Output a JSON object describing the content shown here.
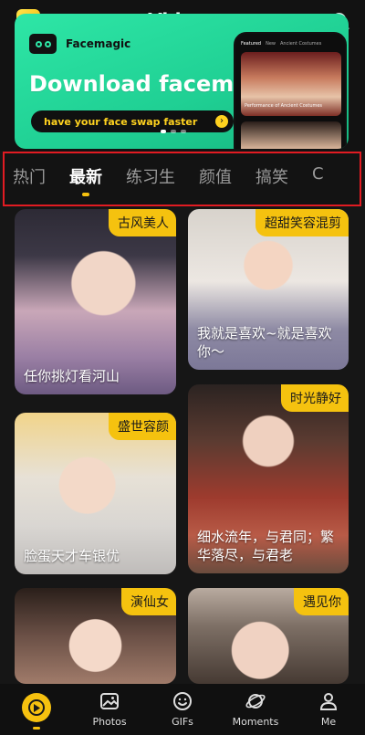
{
  "header": {
    "title": "Videos",
    "logo_glyph": "8"
  },
  "banner": {
    "brand": "Facemagic",
    "headline": "Download facemagic",
    "cta": "have your face swap faster",
    "phone_tabs": [
      "Featured",
      "New",
      "Ancient Costumes"
    ],
    "phone_caption": "Performance of Ancient Costumes"
  },
  "tabs": [
    "热门",
    "最新",
    "练习生",
    "颜值",
    "搞笑",
    "C"
  ],
  "active_tab_index": 1,
  "cards": [
    {
      "badge": "古风美人",
      "caption": "任你挑灯看河山"
    },
    {
      "badge": "超甜笑容混剪",
      "caption": "我就是喜欢~就是喜欢你～"
    },
    {
      "badge": "盛世容颜",
      "caption": "脸蛋天才车银优"
    },
    {
      "badge": "时光静好",
      "caption": "细水流年，与君同；繁华落尽，与君老"
    },
    {
      "badge": "演仙女",
      "caption": ""
    },
    {
      "badge": "遇见你",
      "caption": ""
    }
  ],
  "nav": {
    "items": [
      {
        "label": "",
        "icon": "play-icon"
      },
      {
        "label": "Photos",
        "icon": "photos-icon"
      },
      {
        "label": "GIFs",
        "icon": "smiley-icon"
      },
      {
        "label": "Moments",
        "icon": "planet-icon"
      },
      {
        "label": "Me",
        "icon": "person-icon"
      }
    ]
  },
  "colors": {
    "accent": "#f6c10f",
    "banner_green": "#2ee6a6",
    "highlight_frame": "#e11b22",
    "background": "#161616"
  }
}
